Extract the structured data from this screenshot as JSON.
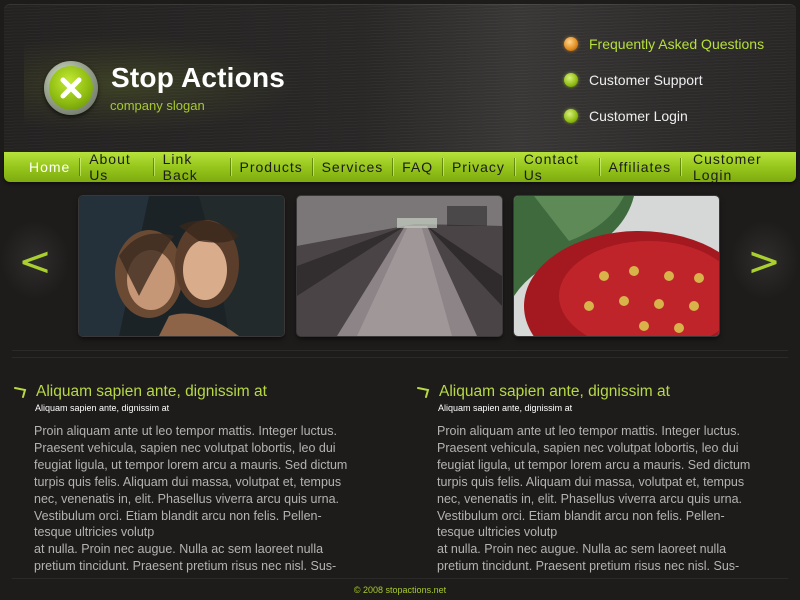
{
  "header": {
    "brand_name": "Stop Actions",
    "slogan": "company slogan",
    "top_links": [
      {
        "label": "Frequently Asked Questions",
        "bullet": "orange",
        "active": true
      },
      {
        "label": "Customer Support",
        "bullet": "green",
        "active": false
      },
      {
        "label": "Customer Login",
        "bullet": "green",
        "active": false
      }
    ]
  },
  "nav": {
    "items": [
      "Home",
      "About Us",
      "Link Back",
      "Products",
      "Services",
      "FAQ",
      "Privacy",
      "Contact Us",
      "Affiliates",
      "Customer Login"
    ],
    "active_index": 0
  },
  "gallery": {
    "prev_icon": "<",
    "next_icon": ">",
    "thumbnails": [
      "women-portrait",
      "moving-walkway",
      "strawberry-closeup"
    ]
  },
  "columns": [
    {
      "title": "Aliquam sapien ante, dignissim at",
      "subtitle": "Aliquam sapien ante, dignissim at",
      "body": "Proin aliquam ante ut leo tempor mattis. Integer luctus.\nPraesent vehicula, sapien nec volutpat lobortis, leo dui\nfeugiat ligula, ut tempor lorem arcu a mauris. Sed dictum\nturpis quis felis. Aliquam dui massa, volutpat et, tempus\nnec, venenatis in, elit. Phasellus viverra arcu quis urna.\nVestibulum orci. Etiam blandit arcu non felis. Pellen-\ntesque ultricies volutp\nat nulla. Proin nec augue. Nulla ac sem laoreet nulla\npretium tincidunt. Praesent pretium risus nec nisl. Sus-"
    },
    {
      "title": "Aliquam sapien ante, dignissim at",
      "subtitle": "Aliquam sapien ante, dignissim at",
      "body": "Proin aliquam ante ut leo tempor mattis. Integer luctus.\nPraesent vehicula, sapien nec volutpat lobortis, leo dui\nfeugiat ligula, ut tempor lorem arcu a mauris. Sed dictum\nturpis quis felis. Aliquam dui massa, volutpat et, tempus\nnec, venenatis in, elit. Phasellus viverra arcu quis urna.\nVestibulum orci. Etiam blandit arcu non felis. Pellen-\ntesque ultricies volutp\nat nulla. Proin nec augue. Nulla ac sem laoreet nulla\npretium tincidunt. Praesent pretium risus nec nisl. Sus-"
    }
  ],
  "footer": {
    "text": "© 2008 stopactions.net"
  },
  "colors": {
    "accent": "#a6c92b",
    "nav_green": "#96c61c",
    "background": "#1e1c1b"
  }
}
